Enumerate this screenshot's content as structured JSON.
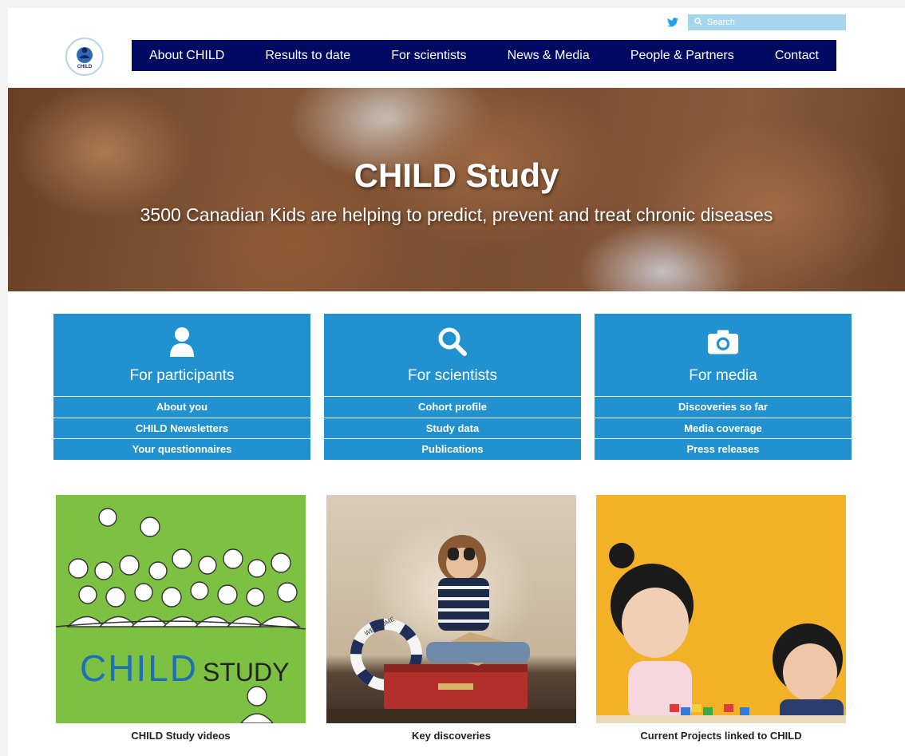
{
  "header": {
    "search_placeholder": "Search",
    "logo_text": "CHILD",
    "nav": [
      {
        "label": "About CHILD"
      },
      {
        "label": "Results to date"
      },
      {
        "label": "For scientists"
      },
      {
        "label": "News & Media"
      },
      {
        "label": "People & Partners"
      },
      {
        "label": "Contact"
      }
    ]
  },
  "hero": {
    "title": "CHILD Study",
    "subtitle": "3500 Canadian Kids are helping to predict, prevent and treat chronic diseases"
  },
  "audiences": [
    {
      "title": "For participants",
      "icon": "user-icon",
      "links": [
        "About you",
        "CHILD Newsletters",
        "Your questionnaires"
      ]
    },
    {
      "title": "For scientists",
      "icon": "search-icon",
      "links": [
        "Cohort profile",
        "Study data",
        "Publications"
      ]
    },
    {
      "title": "For media",
      "icon": "camera-icon",
      "links": [
        "Discoveries so far",
        "Media coverage",
        "Press releases"
      ]
    }
  ],
  "cards": [
    {
      "caption": "CHILD Study videos",
      "image_text_1": "CHILD",
      "image_text_2": "STUDY"
    },
    {
      "caption": "Key discoveries",
      "image_text_1": "WELCOME"
    },
    {
      "caption": "Current Projects linked to CHILD"
    }
  ],
  "colors": {
    "nav_bg": "#000a63",
    "box_bg": "#2192cf",
    "search_bg": "#a6d6ec",
    "green": "#7dc143",
    "yellow": "#f2b126"
  }
}
